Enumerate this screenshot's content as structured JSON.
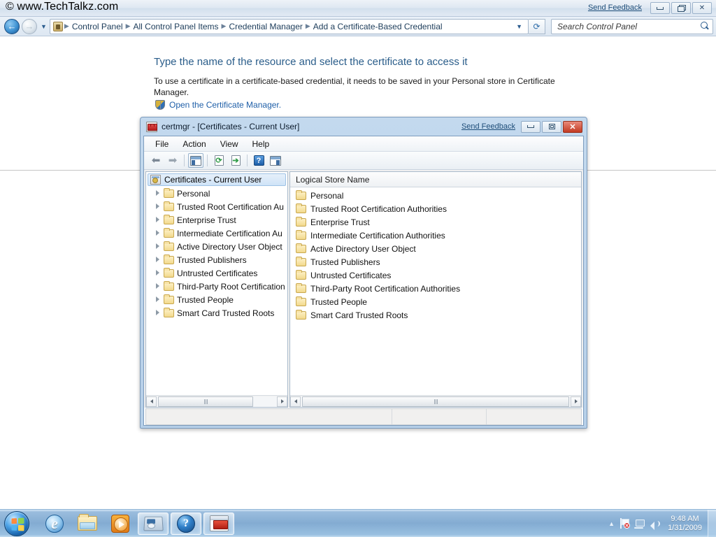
{
  "explorer": {
    "watermark": "© www.TechTalkz.com",
    "send_feedback": "Send Feedback",
    "window_buttons": {
      "minimize": "minimize-button",
      "restore": "restore-button",
      "close": "close-button"
    },
    "breadcrumbs": [
      {
        "label": "Control Panel"
      },
      {
        "label": "All Control Panel Items"
      },
      {
        "label": "Credential Manager"
      },
      {
        "label": "Add a Certificate-Based Credential"
      }
    ],
    "search": {
      "placeholder": "Search Control Panel",
      "value": ""
    }
  },
  "page": {
    "heading": "Type the name of the resource and select the certificate to access it",
    "body": "To use a certificate in a certificate-based credential, it needs to be saved in your Personal store in Certificate Manager.",
    "link": "Open the Certificate Manager."
  },
  "certmgr": {
    "title": "certmgr - [Certificates - Current User]",
    "send_feedback": "Send Feedback",
    "menu": [
      "File",
      "Action",
      "View",
      "Help"
    ],
    "toolbar": [
      {
        "name": "back-button"
      },
      {
        "name": "forward-button"
      },
      {
        "name": "show-hide-tree-button"
      },
      {
        "name": "refresh-button"
      },
      {
        "name": "export-list-button"
      },
      {
        "name": "help-button"
      },
      {
        "name": "show-hide-action-pane-button"
      }
    ],
    "tree": {
      "root": "Certificates - Current User",
      "nodes": [
        "Personal",
        "Trusted Root Certification Au",
        "Enterprise Trust",
        "Intermediate Certification Au",
        "Active Directory User Object",
        "Trusted Publishers",
        "Untrusted Certificates",
        "Third-Party Root Certification",
        "Trusted People",
        "Smart Card Trusted Roots"
      ]
    },
    "list": {
      "column_header": "Logical Store Name",
      "rows": [
        "Personal",
        "Trusted Root Certification Authorities",
        "Enterprise Trust",
        "Intermediate Certification Authorities",
        "Active Directory User Object",
        "Trusted Publishers",
        "Untrusted Certificates",
        "Third-Party Root Certification Authorities",
        "Trusted People",
        "Smart Card Trusted Roots"
      ]
    },
    "status": {
      "main": "",
      "cell_a": "",
      "cell_b": ""
    }
  },
  "taskbar": {
    "start": "start-orb",
    "items": [
      {
        "name": "taskbar-item-internet-explorer",
        "active": false
      },
      {
        "name": "taskbar-item-windows-explorer",
        "active": false
      },
      {
        "name": "taskbar-item-windows-media-player",
        "active": false
      },
      {
        "name": "taskbar-item-control-panel",
        "active": true
      },
      {
        "name": "taskbar-item-windows-help",
        "active": true
      },
      {
        "name": "taskbar-item-certmgr",
        "active": true
      }
    ],
    "tray": {
      "expand": "▲",
      "help_glyph": "?",
      "flag_badge": "✕",
      "time": "9:48 AM",
      "date": "1/31/2009"
    }
  },
  "colors": {
    "accent_blue": "#2a5d8a",
    "link_blue": "#1f5fa8",
    "close_red": "#c23a22",
    "folder_yellow": "#f2d98c",
    "taskbar_blue": "#7ea8d0"
  }
}
